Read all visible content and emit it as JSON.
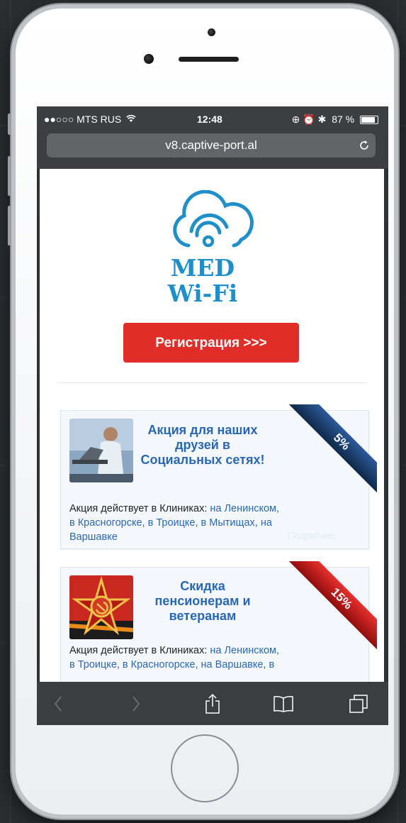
{
  "status_bar": {
    "carrier": "●●○○○ MTS RUS",
    "wifi_icon": "wifi-icon",
    "time": "12:48",
    "indicators": "⊕ ⏰ ✱",
    "battery": "87 %"
  },
  "url_bar": {
    "url": "v8.captive-port.al",
    "reload_icon": "reload-icon"
  },
  "page": {
    "logo_line1": "MED",
    "logo_line2": "Wi-Fi",
    "brand_color": "#1e8fc9",
    "register_button": "Регистрация >>>",
    "register_color": "#e02d27"
  },
  "promos": [
    {
      "title": "Акция для наших друзей в Социальных сетях!",
      "badge": "5%",
      "badge_color": "#1b3a6b",
      "desc_prefix": "Акция действует в Клиниках: ",
      "locations": "на Ленинском, в Красногорске, в Троицке, в Мытищах, на Варшавке",
      "more": "Подробнее"
    },
    {
      "title": "Скидка пенсионерам и ветеранам",
      "badge": "15%",
      "badge_color": "#c0141b",
      "desc_prefix": "Акция действует в Клиниках: ",
      "locations": "на Ленинском, в Троицке, в Красногорске, на Варшавке, в"
    }
  ],
  "toolbar": {
    "back": "back-icon",
    "forward": "forward-icon",
    "share": "share-icon",
    "bookmarks": "bookmarks-icon",
    "tabs": "tabs-icon"
  }
}
